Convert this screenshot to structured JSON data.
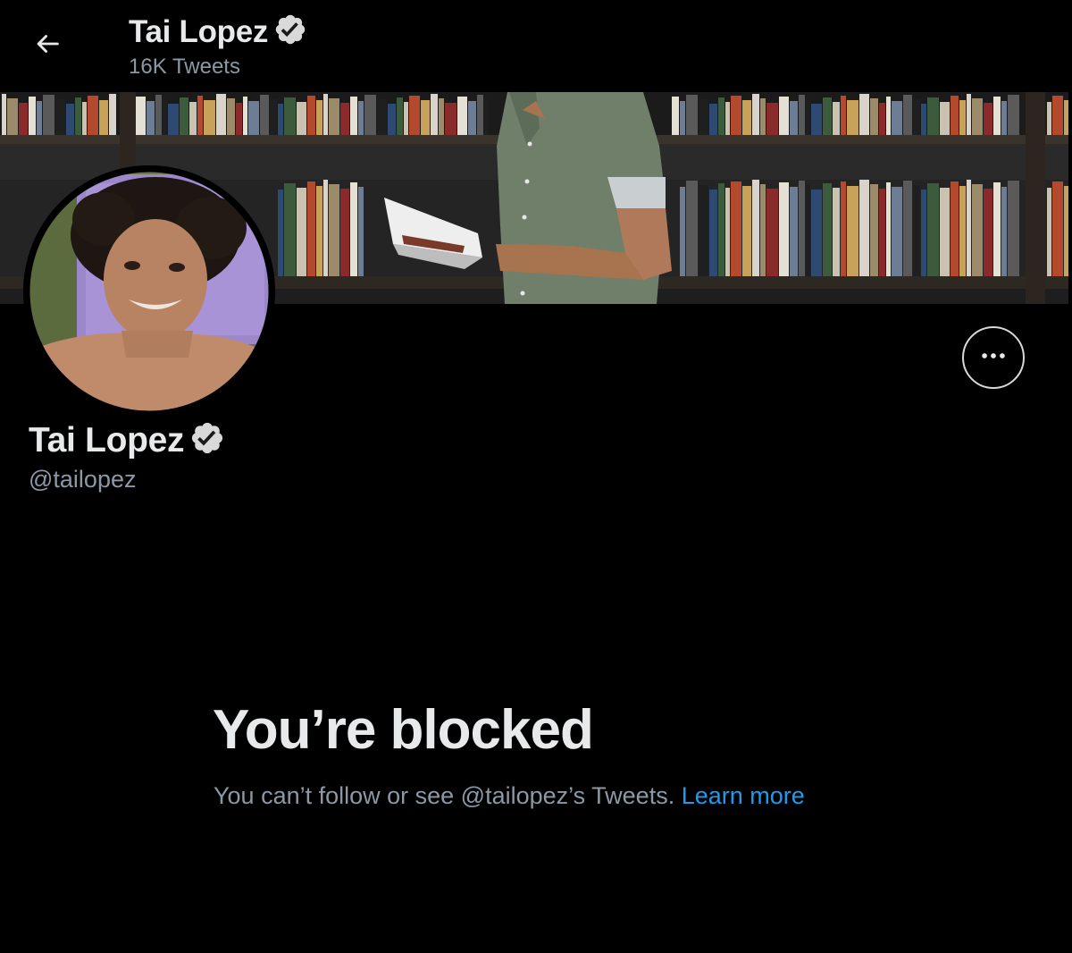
{
  "colors": {
    "background": "#000000",
    "primary_text": "#e7e9ea",
    "secondary_text": "#8b98a5",
    "link": "#1d9bf0",
    "verified_badge": "#d9d9d9"
  },
  "header": {
    "back_icon": "arrow-left-icon",
    "name": "Tai Lopez",
    "verified_icon": "verified-badge-icon",
    "tweet_count": "16K Tweets"
  },
  "profile": {
    "banner_image": "bookshelf-banner",
    "avatar_image": "profile-avatar",
    "more_icon": "more-horizontal-icon",
    "name": "Tai Lopez",
    "verified_icon": "verified-badge-icon",
    "handle": "@tailopez"
  },
  "blocked": {
    "title": "You’re blocked",
    "message": "You can’t follow or see @tailopez’s Tweets.",
    "link_label": "Learn more"
  }
}
